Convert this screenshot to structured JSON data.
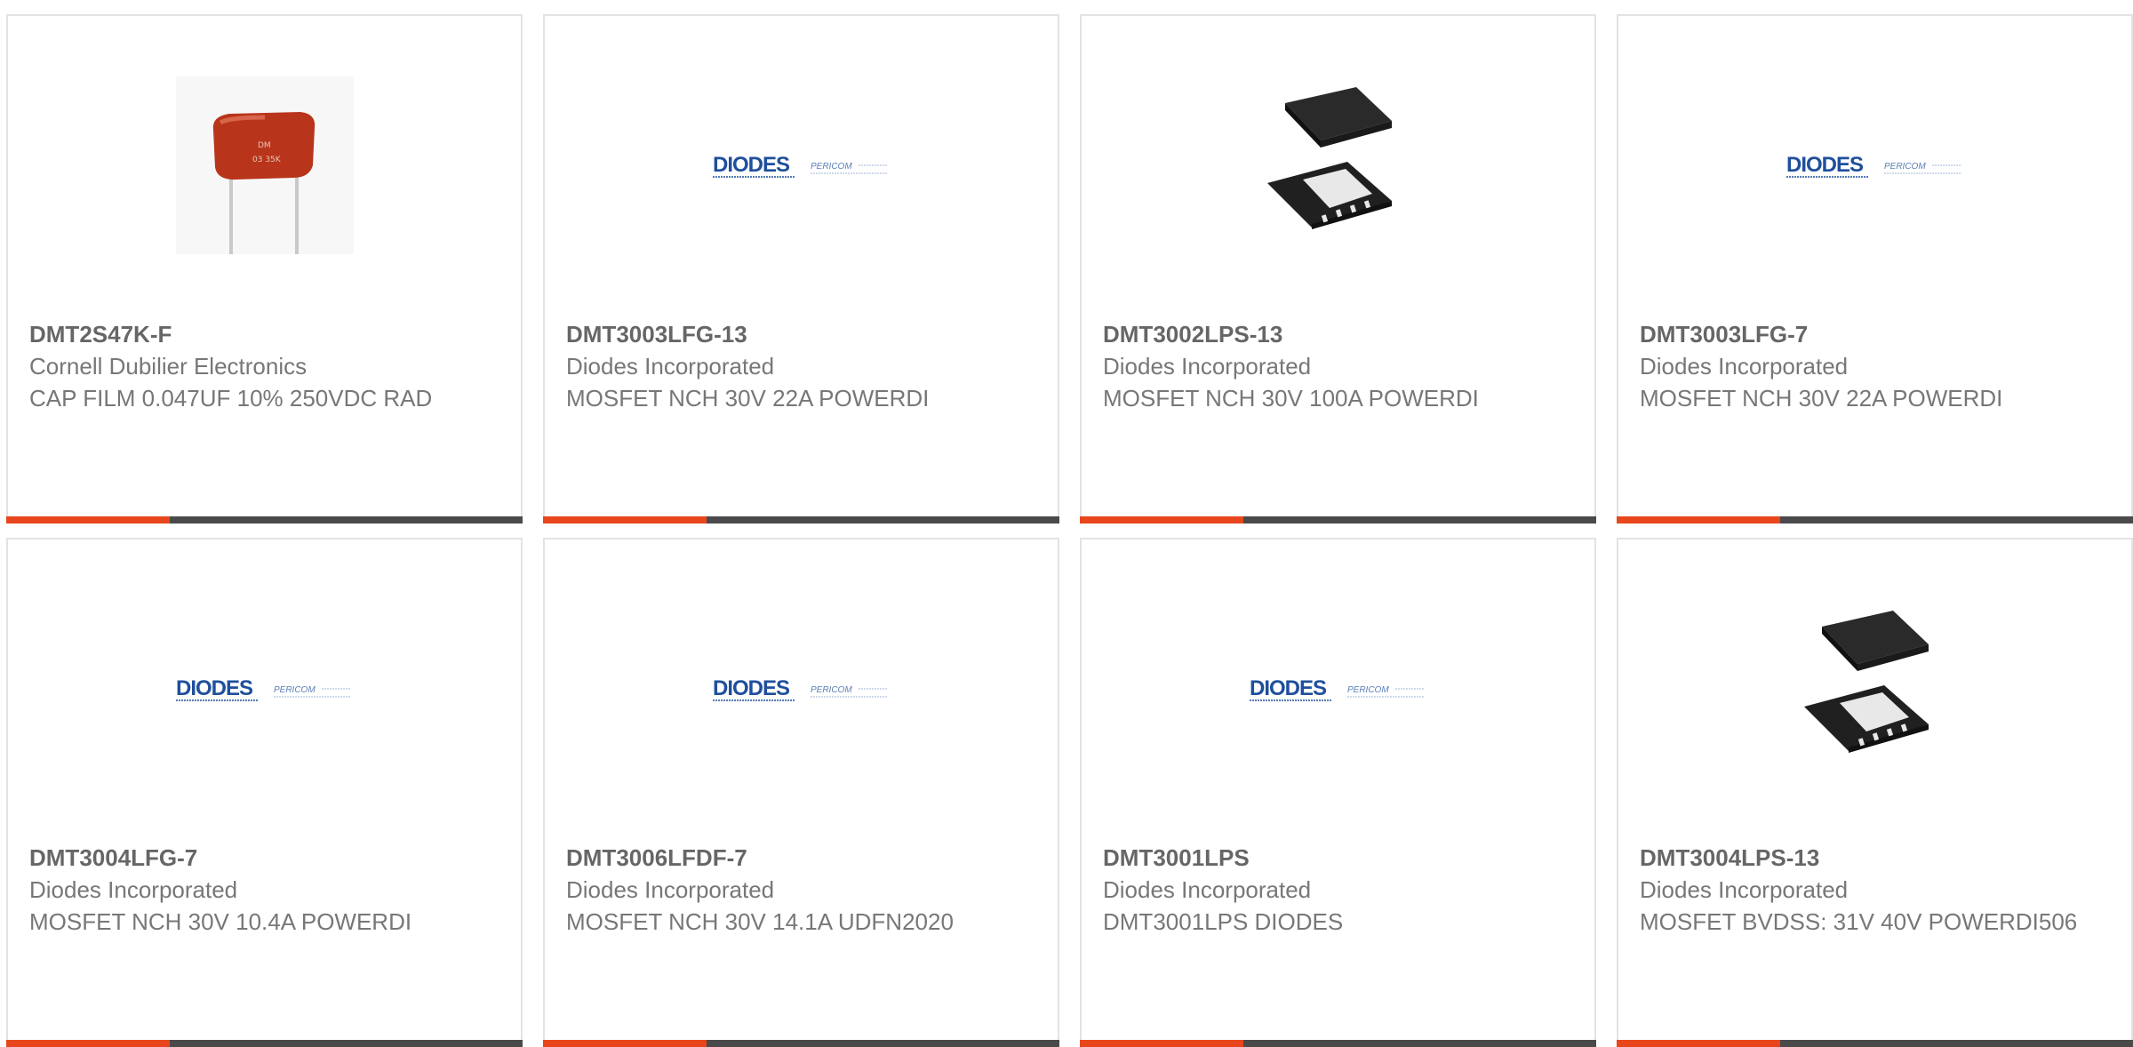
{
  "colors": {
    "accent": "#e8461c",
    "bar": "#4a4a4a",
    "text": "#777777",
    "diodes_blue": "#1f4f9c",
    "capacitor_red": "#b8341b"
  },
  "products": [
    {
      "part_number": "DMT2S47K-F",
      "manufacturer": "Cornell Dubilier Electronics",
      "description": "CAP FILM 0.047UF 10% 250VDC RAD",
      "image": "capacitor-image"
    },
    {
      "part_number": "DMT3003LFG-13",
      "manufacturer": "Diodes Incorporated",
      "description": "MOSFET NCH 30V 22A POWERDI",
      "image": "diodes-pericom-logo"
    },
    {
      "part_number": "DMT3002LPS-13",
      "manufacturer": "Diodes Incorporated",
      "description": "MOSFET NCH 30V 100A POWERDI",
      "image": "powerdi-package-image"
    },
    {
      "part_number": "DMT3003LFG-7",
      "manufacturer": "Diodes Incorporated",
      "description": "MOSFET NCH 30V 22A POWERDI",
      "image": "diodes-pericom-logo"
    },
    {
      "part_number": "DMT3004LFG-7",
      "manufacturer": "Diodes Incorporated",
      "description": "MOSFET NCH 30V 10.4A POWERDI",
      "image": "diodes-pericom-logo"
    },
    {
      "part_number": "DMT3006LFDF-7",
      "manufacturer": "Diodes Incorporated",
      "description": "MOSFET NCH 30V 14.1A UDFN2020",
      "image": "diodes-pericom-logo"
    },
    {
      "part_number": "DMT3001LPS",
      "manufacturer": "Diodes Incorporated",
      "description": "DMT3001LPS DIODES",
      "image": "diodes-pericom-logo"
    },
    {
      "part_number": "DMT3004LPS-13",
      "manufacturer": "Diodes Incorporated",
      "description": "MOSFET BVDSS: 31V 40V POWERDI506",
      "image": "powerdi-package-image"
    }
  ],
  "logo": {
    "brand": "DIODES",
    "sub": "PERICOM"
  }
}
